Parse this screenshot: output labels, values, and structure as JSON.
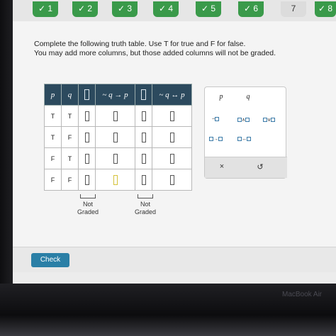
{
  "progress": {
    "steps": [
      {
        "label": "✓ 1",
        "state": "done"
      },
      {
        "label": "✓ 2",
        "state": "done"
      },
      {
        "label": "✓ 3",
        "state": "done"
      },
      {
        "label": "✓ 4",
        "state": "done"
      },
      {
        "label": "✓ 5",
        "state": "done"
      },
      {
        "label": "✓ 6",
        "state": "done"
      },
      {
        "label": "7",
        "state": "current"
      },
      {
        "label": "✓ 8",
        "state": "done"
      }
    ]
  },
  "instructions": {
    "line1": "Complete the following truth table. Use T for true and F for false.",
    "line2": "You may add more columns, but those added columns will not be graded."
  },
  "table": {
    "headers": {
      "p": "p",
      "q": "q",
      "expr1": "~ q → p",
      "expr2": "~ q ↔ p"
    },
    "rows": [
      {
        "p": "T",
        "q": "T"
      },
      {
        "p": "T",
        "q": "F"
      },
      {
        "p": "F",
        "q": "T"
      },
      {
        "p": "F",
        "q": "F"
      }
    ],
    "not_graded_1": "Not\nGraded",
    "not_graded_2": "Not\nGraded"
  },
  "palette": {
    "var_p": "p",
    "var_q": "q",
    "op_not": "~",
    "op_and": "∧",
    "op_or": "∨",
    "op_cond": "→",
    "op_bicond": "↔",
    "clear": "×",
    "undo": "↺"
  },
  "bottom": {
    "check": "Check"
  },
  "device": {
    "brand": "MacBook Air"
  },
  "colors": {
    "step_done": "#3a9a4a",
    "table_header": "#2c4a5e",
    "check_button": "#2a7fa6"
  }
}
